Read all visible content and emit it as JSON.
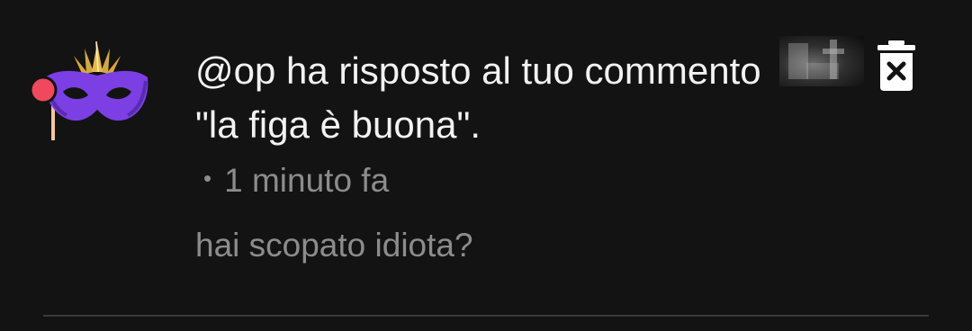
{
  "notification": {
    "title": "@op ha risposto al tuo commento \"la figa è buona\".",
    "time": "1 minuto fa",
    "bullet": "•",
    "body": "hai scopato idiota?",
    "avatar_icon": "masquerade-mask-icon",
    "delete_icon": "trash-icon"
  },
  "colors": {
    "background": "#131313",
    "title_text": "#f2f2f2",
    "secondary_text": "#8c8c8c",
    "mask_purple": "#7b3fe4",
    "mask_red_dot": "#f0485c",
    "feathers_gold": "#e8b84a",
    "divider": "#3a3a3a"
  }
}
